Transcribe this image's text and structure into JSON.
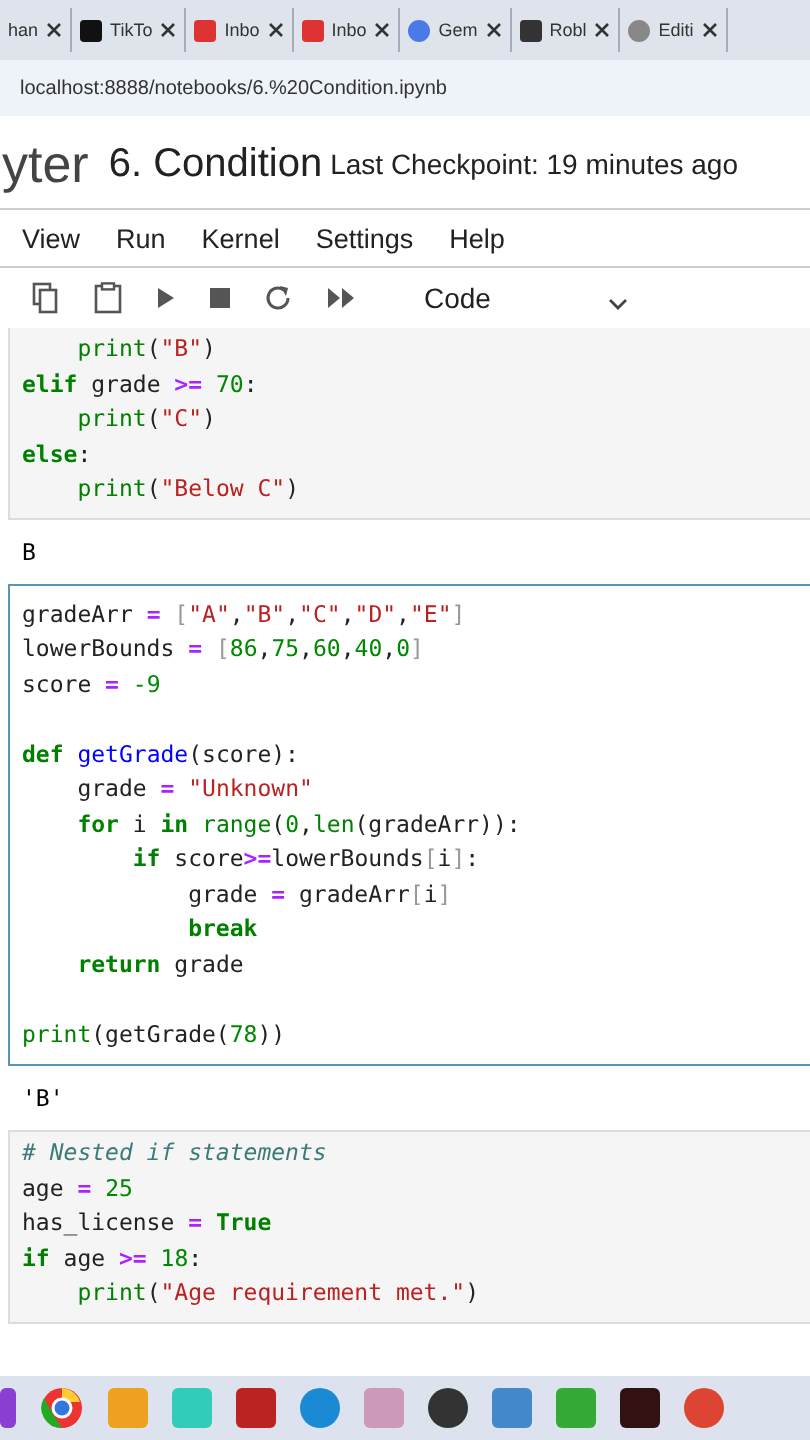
{
  "browser_tabs": [
    {
      "label": "han",
      "selected": false
    },
    {
      "label": "TikTo",
      "selected": false
    },
    {
      "label": "Inbo",
      "selected": false
    },
    {
      "label": "Inbo",
      "selected": false
    },
    {
      "label": "Gem",
      "selected": false
    },
    {
      "label": "Robl",
      "selected": false
    },
    {
      "label": "Editi",
      "selected": false
    }
  ],
  "address": "localhost:8888/notebooks/6.%20Condition.ipynb",
  "header": {
    "logo": "yter",
    "title": "6. Condition",
    "checkpoint": "Last Checkpoint: 19 minutes ago"
  },
  "menu": [
    "View",
    "Run",
    "Kernel",
    "Settings",
    "Help"
  ],
  "cell_type": "Code",
  "cells": [
    {
      "selected": false,
      "lines": [
        {
          "space_before": false,
          "segments": [
            {
              "t": "    print",
              "kind": "bi"
            },
            {
              "t": "(",
              "kind": "n"
            },
            {
              "t": "\"B\"",
              "kind": "str"
            },
            {
              "t": ")",
              "kind": "n"
            }
          ]
        },
        {
          "space_before": false,
          "segments": [
            {
              "t": "elif",
              "kind": "kw"
            },
            {
              "t": " grade ",
              "kind": "n"
            },
            {
              "t": ">=",
              "kind": "op"
            },
            {
              "t": " 70",
              "kind": "num"
            },
            {
              "t": ":",
              "kind": "n"
            }
          ]
        },
        {
          "space_before": false,
          "segments": [
            {
              "t": "    print",
              "kind": "bi"
            },
            {
              "t": "(",
              "kind": "n"
            },
            {
              "t": "\"C\"",
              "kind": "str"
            },
            {
              "t": ")",
              "kind": "n"
            }
          ]
        },
        {
          "space_before": false,
          "segments": [
            {
              "t": "else",
              "kind": "kw"
            },
            {
              "t": ":",
              "kind": "n"
            }
          ]
        },
        {
          "space_before": false,
          "segments": [
            {
              "t": "    print",
              "kind": "bi"
            },
            {
              "t": "(",
              "kind": "n"
            },
            {
              "t": "\"Below C\"",
              "kind": "str"
            },
            {
              "t": ")",
              "kind": "n"
            }
          ]
        }
      ],
      "output": "B"
    },
    {
      "selected": true,
      "lines": [
        {
          "space_before": false,
          "segments": [
            {
              "t": "gradeArr ",
              "kind": "n"
            },
            {
              "t": "=",
              "kind": "op"
            },
            {
              "t": " [",
              "kind": "br"
            },
            {
              "t": "\"A\"",
              "kind": "str"
            },
            {
              "t": ",",
              "kind": "n"
            },
            {
              "t": "\"B\"",
              "kind": "str"
            },
            {
              "t": ",",
              "kind": "n"
            },
            {
              "t": "\"C\"",
              "kind": "str"
            },
            {
              "t": ",",
              "kind": "n"
            },
            {
              "t": "\"D\"",
              "kind": "str"
            },
            {
              "t": ",",
              "kind": "n"
            },
            {
              "t": "\"E\"",
              "kind": "str"
            },
            {
              "t": "]",
              "kind": "br"
            }
          ]
        },
        {
          "space_before": false,
          "segments": [
            {
              "t": "lowerBounds ",
              "kind": "n"
            },
            {
              "t": "=",
              "kind": "op"
            },
            {
              "t": " [",
              "kind": "br"
            },
            {
              "t": "86",
              "kind": "num"
            },
            {
              "t": ",",
              "kind": "n"
            },
            {
              "t": "75",
              "kind": "num"
            },
            {
              "t": ",",
              "kind": "n"
            },
            {
              "t": "60",
              "kind": "num"
            },
            {
              "t": ",",
              "kind": "n"
            },
            {
              "t": "40",
              "kind": "num"
            },
            {
              "t": ",",
              "kind": "n"
            },
            {
              "t": "0",
              "kind": "num"
            },
            {
              "t": "]",
              "kind": "br"
            }
          ]
        },
        {
          "space_before": false,
          "segments": [
            {
              "t": "score ",
              "kind": "n"
            },
            {
              "t": "=",
              "kind": "op"
            },
            {
              "t": " -9",
              "kind": "num"
            }
          ]
        },
        {
          "space_before": true,
          "segments": [
            {
              "t": "def",
              "kind": "kw"
            },
            {
              "t": " getGrade",
              "kind": "fn"
            },
            {
              "t": "(score):",
              "kind": "n"
            }
          ]
        },
        {
          "space_before": false,
          "segments": [
            {
              "t": "    grade ",
              "kind": "n"
            },
            {
              "t": "=",
              "kind": "op"
            },
            {
              "t": " \"Unknown\"",
              "kind": "str"
            }
          ]
        },
        {
          "space_before": false,
          "segments": [
            {
              "t": "    for",
              "kind": "kw"
            },
            {
              "t": " i ",
              "kind": "n"
            },
            {
              "t": "in",
              "kind": "kw"
            },
            {
              "t": " range",
              "kind": "bi"
            },
            {
              "t": "(",
              "kind": "n"
            },
            {
              "t": "0",
              "kind": "num"
            },
            {
              "t": ",",
              "kind": "n"
            },
            {
              "t": "len",
              "kind": "bi"
            },
            {
              "t": "(gradeArr)):",
              "kind": "n"
            }
          ]
        },
        {
          "space_before": false,
          "segments": [
            {
              "t": "        if",
              "kind": "kw"
            },
            {
              "t": " score",
              "kind": "n"
            },
            {
              "t": ">=",
              "kind": "op"
            },
            {
              "t": "lowerBounds",
              "kind": "n"
            },
            {
              "t": "[",
              "kind": "br"
            },
            {
              "t": "i",
              "kind": "n"
            },
            {
              "t": "]",
              "kind": "br"
            },
            {
              "t": ":",
              "kind": "n"
            }
          ]
        },
        {
          "space_before": false,
          "segments": [
            {
              "t": "            grade ",
              "kind": "n"
            },
            {
              "t": "=",
              "kind": "op"
            },
            {
              "t": " gradeArr",
              "kind": "n"
            },
            {
              "t": "[",
              "kind": "br"
            },
            {
              "t": "i",
              "kind": "n"
            },
            {
              "t": "]",
              "kind": "br"
            }
          ]
        },
        {
          "space_before": false,
          "segments": [
            {
              "t": "            break",
              "kind": "kw"
            }
          ]
        },
        {
          "space_before": false,
          "segments": [
            {
              "t": "    return",
              "kind": "kw"
            },
            {
              "t": " grade",
              "kind": "n"
            }
          ]
        },
        {
          "space_before": true,
          "segments": [
            {
              "t": "print",
              "kind": "bi"
            },
            {
              "t": "(getGrade(",
              "kind": "n"
            },
            {
              "t": "78",
              "kind": "num"
            },
            {
              "t": "))",
              "kind": "n"
            }
          ]
        }
      ],
      "output": "'B'"
    },
    {
      "selected": false,
      "lines": [
        {
          "space_before": false,
          "segments": [
            {
              "t": "# Nested if statements",
              "kind": "cm"
            }
          ]
        },
        {
          "space_before": false,
          "segments": [
            {
              "t": "age ",
              "kind": "n"
            },
            {
              "t": "=",
              "kind": "op"
            },
            {
              "t": " 25",
              "kind": "num"
            }
          ]
        },
        {
          "space_before": false,
          "segments": [
            {
              "t": "has_license ",
              "kind": "n"
            },
            {
              "t": "=",
              "kind": "op"
            },
            {
              "t": " True",
              "kind": "kw"
            }
          ]
        },
        {
          "space_before": false,
          "segments": [
            {
              "t": "if",
              "kind": "kw"
            },
            {
              "t": " age ",
              "kind": "n"
            },
            {
              "t": ">=",
              "kind": "op"
            },
            {
              "t": " 18",
              "kind": "num"
            },
            {
              "t": ":",
              "kind": "n"
            }
          ]
        },
        {
          "space_before": false,
          "segments": [
            {
              "t": "    print",
              "kind": "bi"
            },
            {
              "t": "(",
              "kind": "n"
            },
            {
              "t": "\"Age requirement met.\"",
              "kind": "str"
            },
            {
              "t": ")",
              "kind": "n"
            }
          ]
        }
      ]
    }
  ]
}
